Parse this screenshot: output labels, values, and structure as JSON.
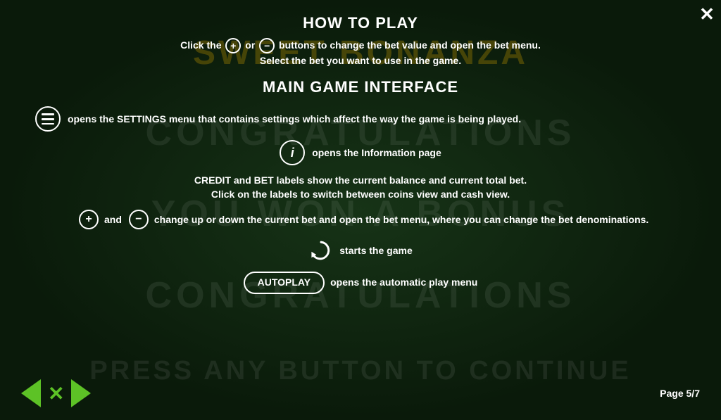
{
  "background": {
    "title": "SWEET BONANZA",
    "sub1": "CONGRATULATIONS",
    "sub2": "YOU WON A BONUS",
    "sub3": "CONGRATULATIONS",
    "sub4": "PRESS ANY BUTTON TO CONTINUE"
  },
  "close_button": "✕",
  "how_to_play": {
    "title": "HOW TO PLAY",
    "line1_prefix": "Click the",
    "line1_plus": "+",
    "line1_or": "or",
    "line1_minus": "−",
    "line1_suffix": "buttons to change the bet value and open the bet menu.",
    "line2": "Select the bet you want to use in the game."
  },
  "main_game": {
    "title": "MAIN GAME INTERFACE",
    "hamburger_desc": "opens the SETTINGS menu that contains settings which affect the way the game is being played.",
    "info_desc": "opens the Information page",
    "credit_bet_desc": "CREDIT and BET labels show the current balance and current total bet.\nClick on the labels to switch between coins view and cash view.",
    "plus_minus_desc": "change up or down the current bet and open the bet menu, where you can change the bet denominations.",
    "spin_desc": "starts the game",
    "autoplay_label": "AUTOPLAY",
    "autoplay_desc": "opens the automatic play menu"
  },
  "navigation": {
    "prev_label": "◀",
    "x_label": "✕",
    "next_label": "▶",
    "page_indicator": "Page 5/7"
  }
}
